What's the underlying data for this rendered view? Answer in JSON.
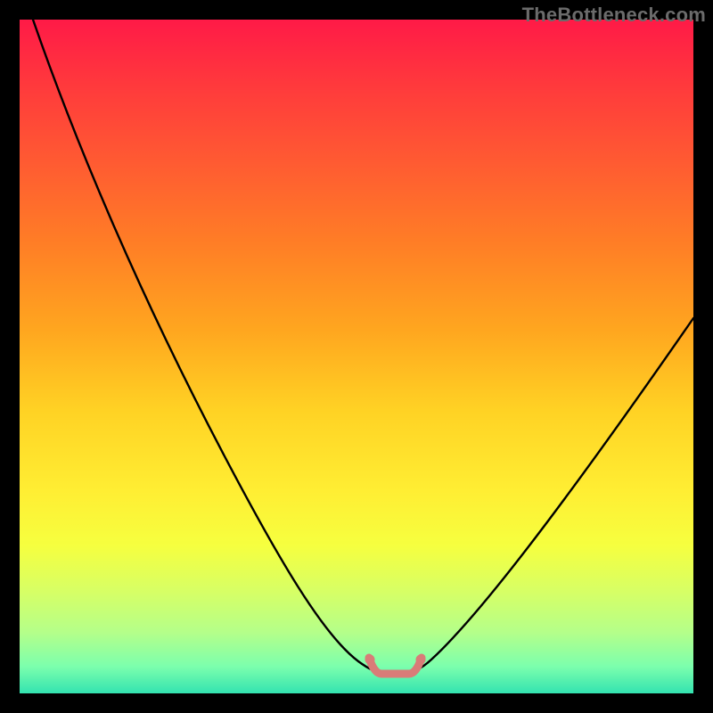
{
  "watermark": "TheBottleneck.com",
  "chart_data": {
    "type": "line",
    "title": "",
    "xlabel": "",
    "ylabel": "",
    "xlim": [
      0,
      100
    ],
    "ylim": [
      0,
      100
    ],
    "series": [
      {
        "name": "bottleneck-curve",
        "x": [
          2,
          10,
          20,
          30,
          40,
          46,
          50,
          52,
          54,
          56,
          58,
          60,
          63,
          70,
          80,
          90,
          100
        ],
        "y": [
          100,
          84,
          65,
          46,
          27,
          14,
          6,
          4,
          3.5,
          3.5,
          4,
          6,
          10,
          20,
          33,
          45,
          56
        ]
      },
      {
        "name": "optimal-zone-marker",
        "x": [
          52,
          53,
          54,
          55,
          56,
          57,
          58
        ],
        "y": [
          5,
          4,
          3.5,
          3.5,
          3.5,
          4,
          5
        ]
      }
    ],
    "colors": {
      "curve": "#000000",
      "marker": "#d97c78",
      "gradient_top": "#ff1a47",
      "gradient_mid": "#ffd224",
      "gradient_bottom": "#33e3b0"
    }
  }
}
